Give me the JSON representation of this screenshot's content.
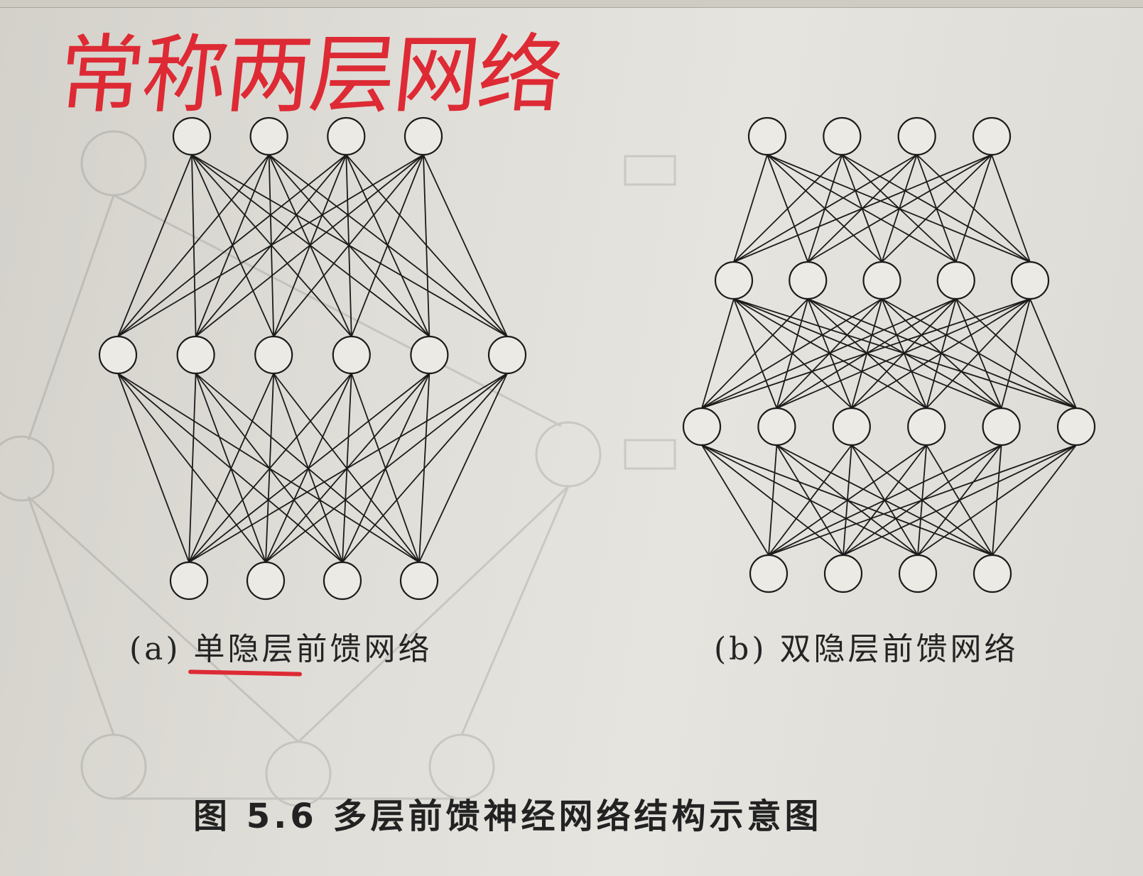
{
  "handwritten_note": "常称两层网络",
  "subfigure_a": {
    "caption": "(a) 单隐层前馈网络",
    "layers": [
      4,
      6,
      4
    ]
  },
  "subfigure_b": {
    "caption": "(b) 双隐层前馈网络",
    "layers": [
      4,
      5,
      6,
      4
    ]
  },
  "figure_caption": "图 5.6   多层前馈神经网络结构示意图",
  "colors": {
    "ink": "#1b1b1b",
    "annotation_red": "#dd2a34",
    "paper": "#e3e1dc"
  }
}
